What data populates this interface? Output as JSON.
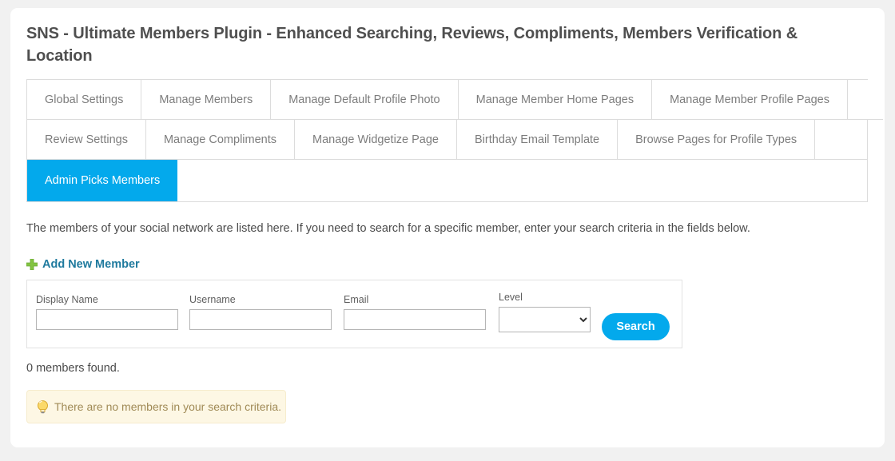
{
  "page": {
    "title": "SNS - Ultimate Members Plugin - Enhanced Searching, Reviews, Compliments, Members Verification & Location",
    "background_color": "#f1f1f1",
    "card_color": "#ffffff",
    "accent_color": "#03a9ec"
  },
  "tabs": {
    "row1": [
      {
        "label": "Global Settings",
        "active": false
      },
      {
        "label": "Manage Members",
        "active": false
      },
      {
        "label": "Manage Default Profile Photo",
        "active": false
      },
      {
        "label": "Manage Member Home Pages",
        "active": false
      },
      {
        "label": "Manage Member Profile Pages",
        "active": false
      }
    ],
    "row2": [
      {
        "label": "Review Settings",
        "active": false
      },
      {
        "label": "Manage Compliments",
        "active": false
      },
      {
        "label": "Manage Widgetize Page",
        "active": false
      },
      {
        "label": "Birthday Email Template",
        "active": false
      },
      {
        "label": "Browse Pages for Profile Types",
        "active": false
      }
    ],
    "row3": [
      {
        "label": "Admin Picks Members",
        "active": true
      }
    ]
  },
  "content": {
    "intro": "The members of your social network are listed here. If you need to search for a specific member, enter your search criteria in the fields below.",
    "add_new_member": {
      "label": "Add New Member",
      "icon": "plus-icon",
      "icon_color": "#83c441",
      "link_color": "#1f7a9e"
    },
    "results_count": "0 members found.",
    "notice": {
      "text": "There are no members in your search criteria.",
      "icon": "lightbulb-icon",
      "background_color": "#fdf7e4",
      "border_color": "#f6eccd",
      "text_color": "#a08a56"
    }
  },
  "search_form": {
    "fields": [
      {
        "label": "Display Name",
        "value": "",
        "placeholder": "",
        "type": "text"
      },
      {
        "label": "Username",
        "value": "",
        "placeholder": "",
        "type": "text"
      },
      {
        "label": "Email",
        "value": "",
        "placeholder": "",
        "type": "text"
      },
      {
        "label": "Level",
        "value": "",
        "placeholder": "",
        "type": "select"
      }
    ],
    "level_options": [
      ""
    ],
    "search_button": {
      "label": "Search",
      "color": "#03a9ec"
    }
  }
}
